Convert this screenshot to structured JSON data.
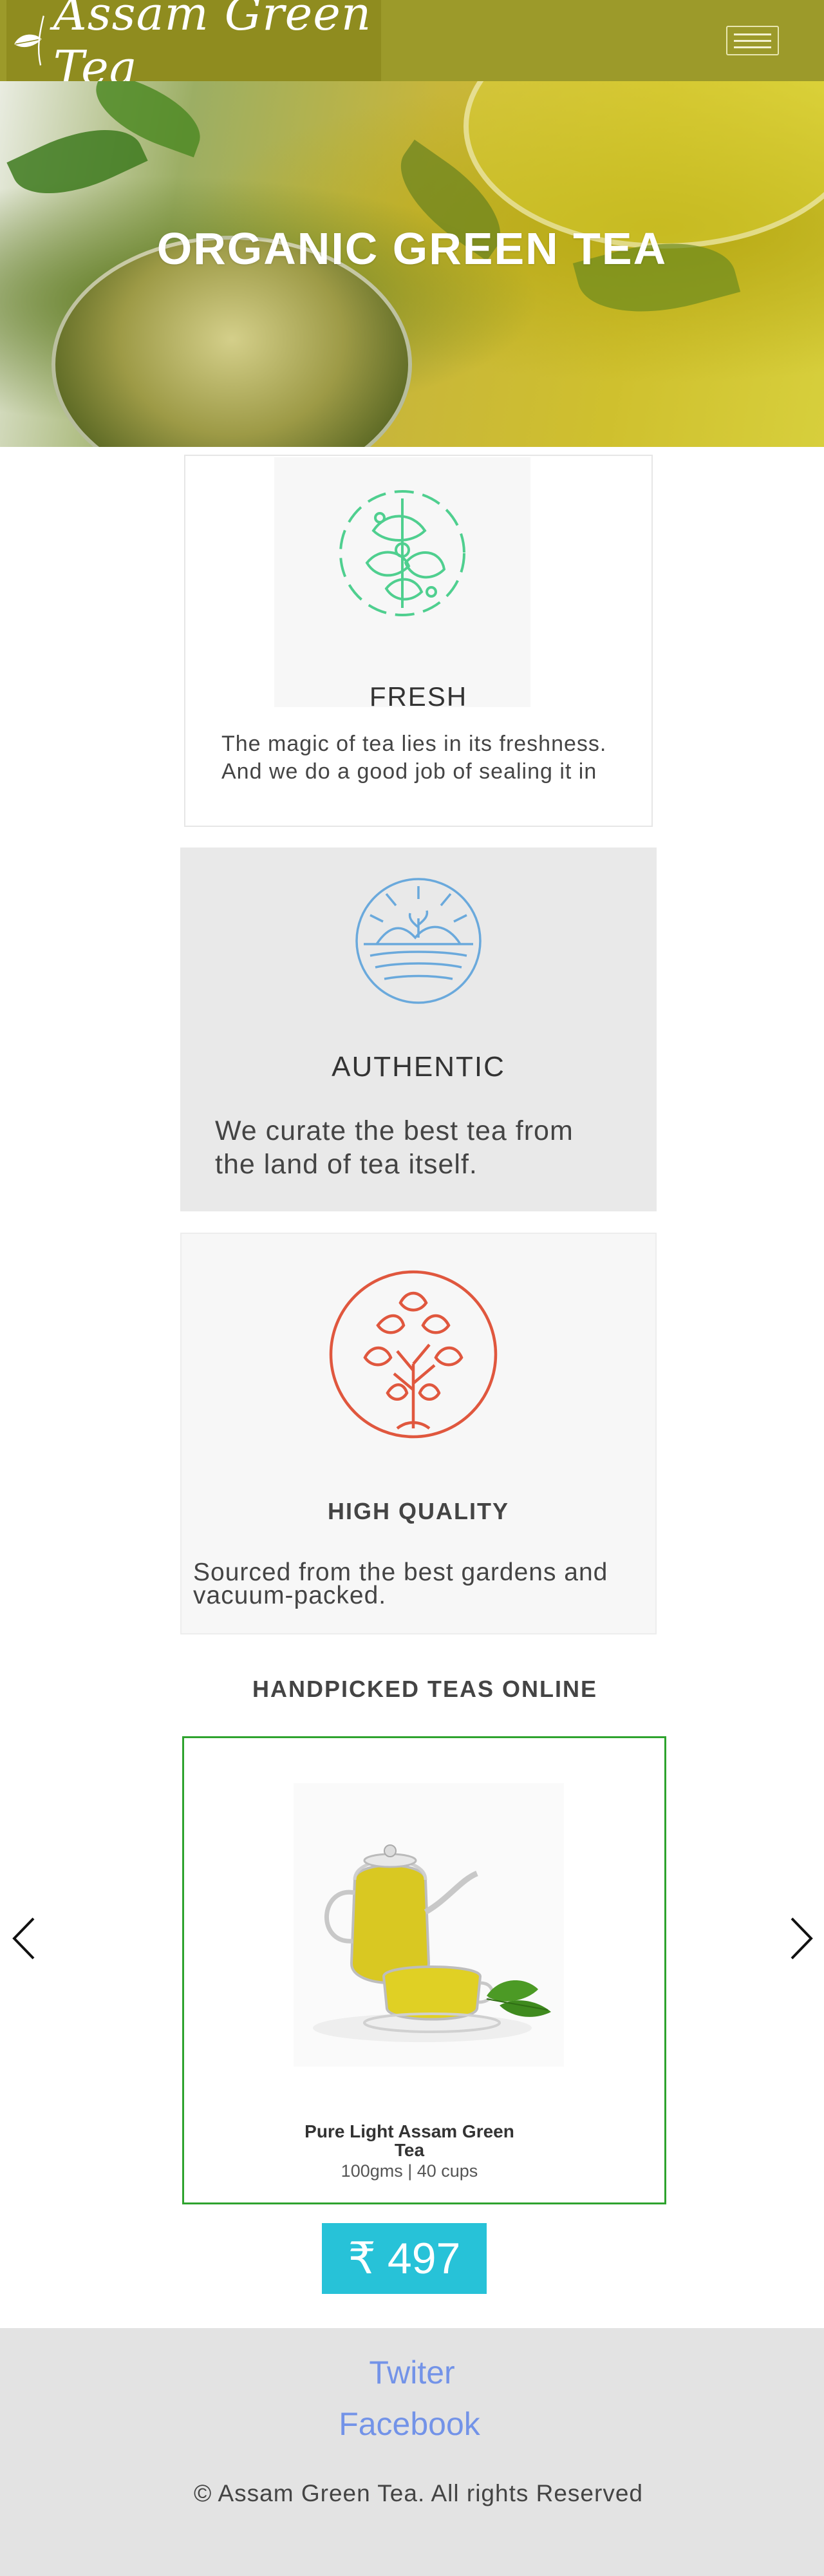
{
  "header": {
    "brand": "Assam Green Tea",
    "menu_icon": "hamburger-menu-icon"
  },
  "hero": {
    "title": "ORGANIC GREEN TEA"
  },
  "features": [
    {
      "title": "FRESH",
      "text_line1": "The magic of tea lies in its freshness.",
      "text_line2": "And we do a good job of sealing it in",
      "icon": "floral-circle-icon",
      "icon_color": "#4fcf8f"
    },
    {
      "title": "AUTHENTIC",
      "text_line1": "We curate the best tea from",
      "text_line2": "the land of tea itself.",
      "icon": "tea-garden-sunrise-icon",
      "icon_color": "#6aa9dc"
    },
    {
      "title": "HIGH QUALITY",
      "text_line1": "Sourced from the best gardens and",
      "text_line2": "vacuum-packed.",
      "icon": "tree-circle-icon",
      "icon_color": "#e0573e"
    }
  ],
  "products": {
    "heading": "HANDPICKED TEAS ONLINE",
    "prev_icon": "chevron-left-icon",
    "next_icon": "chevron-right-icon",
    "item": {
      "name_line1": "Pure Light Assam Green",
      "name_line2": "Tea",
      "size": "100gms | 40 cups",
      "currency_symbol": "₹",
      "price": "497"
    },
    "border_color": "#2ea32e",
    "price_color": "#27c2d8"
  },
  "footer": {
    "link1": "Twiter",
    "link2": "Facebook",
    "copyright": "© Assam Green Tea. All rights Reserved"
  },
  "colors": {
    "navbar": "#9c9a2a",
    "link": "#7393e8"
  }
}
